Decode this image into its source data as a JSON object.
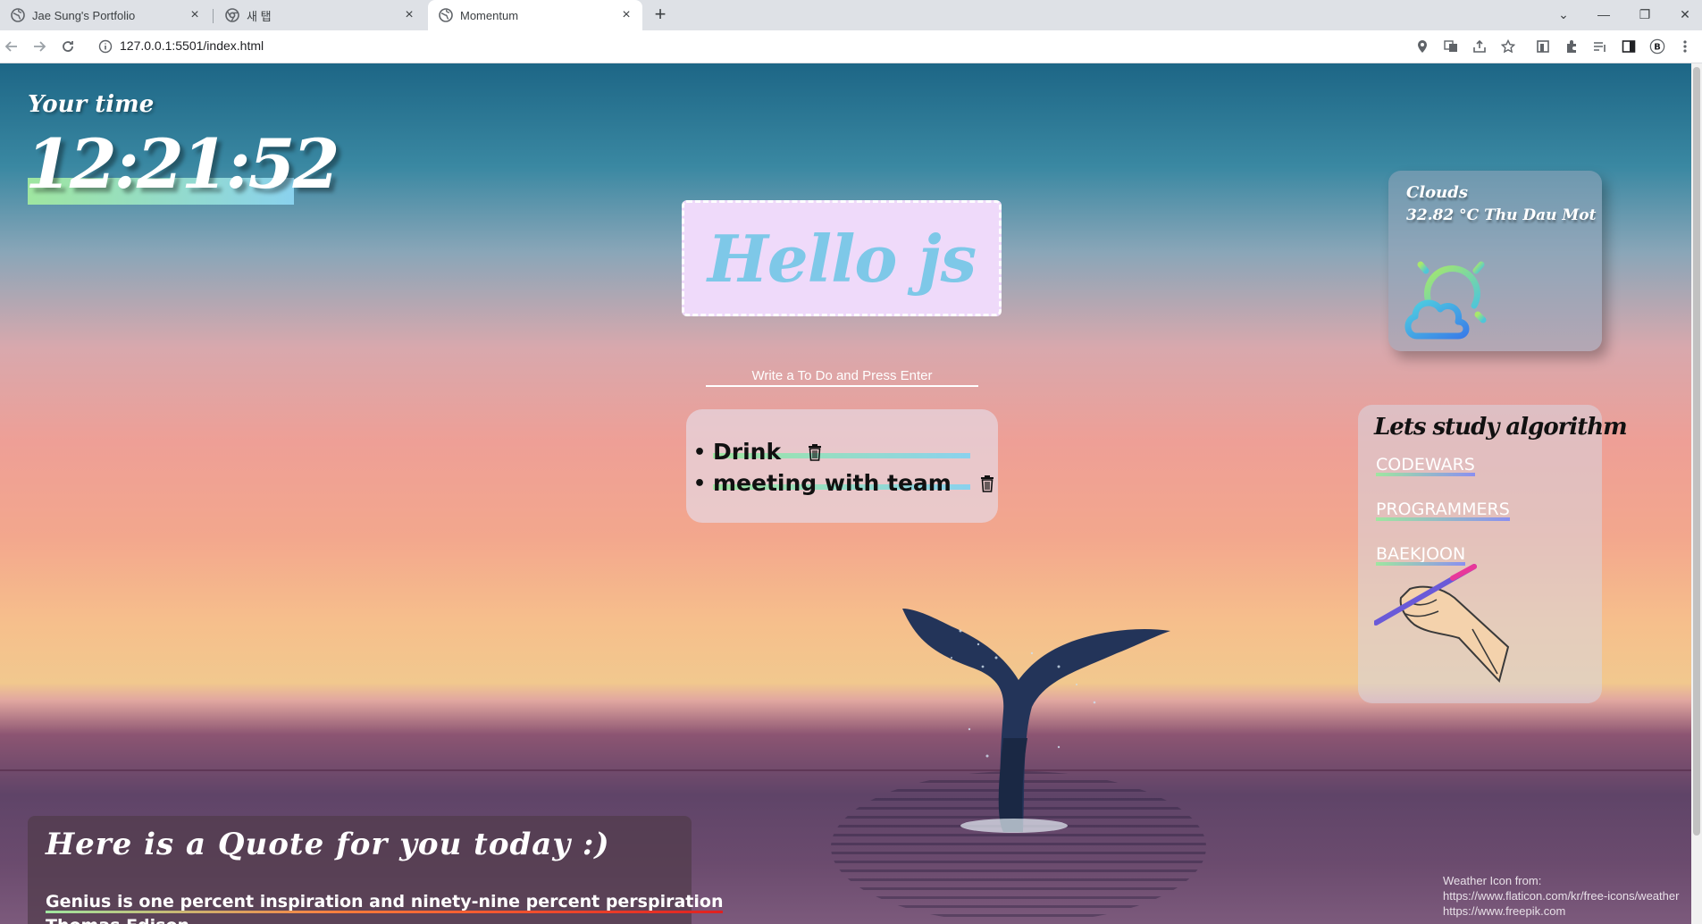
{
  "browser": {
    "tabs": [
      {
        "title": "Jae Sung's Portfolio",
        "active": false
      },
      {
        "title": "새 탭",
        "active": false
      },
      {
        "title": "Momentum",
        "active": true
      }
    ],
    "url": "127.0.0.1:5501/index.html"
  },
  "clock": {
    "label": "Your time",
    "time": "12:21:52"
  },
  "greeting": "Hello js",
  "todo": {
    "placeholder": "Write a To Do and Press Enter",
    "items": [
      {
        "text": "Drink"
      },
      {
        "text": "meeting with team"
      }
    ]
  },
  "weather": {
    "condition": "Clouds",
    "temp_city": "32.82 °C Thu Dau Mot",
    "icon": "sun-cloud-icon"
  },
  "algorithm": {
    "title": "Lets study algorithm",
    "links": [
      "CODEWARS",
      "PROGRAMMERS",
      "BAEKJOON"
    ]
  },
  "quote": {
    "title": "Here is a Quote for you today :)",
    "text": "Genius is one percent inspiration and ninety-nine percent perspiration",
    "author": "Thomas Edison"
  },
  "credit": {
    "line1": "Weather Icon from:",
    "line2": "https://www.flaticon.com/kr/free-icons/weather",
    "line3": "https://www.freepik.com"
  },
  "colors": {
    "greeting_bg": "#efdafa",
    "greeting_text": "#7ec8e8",
    "highlight_start": "#9fe6a0",
    "highlight_end": "#8ad2ee"
  }
}
